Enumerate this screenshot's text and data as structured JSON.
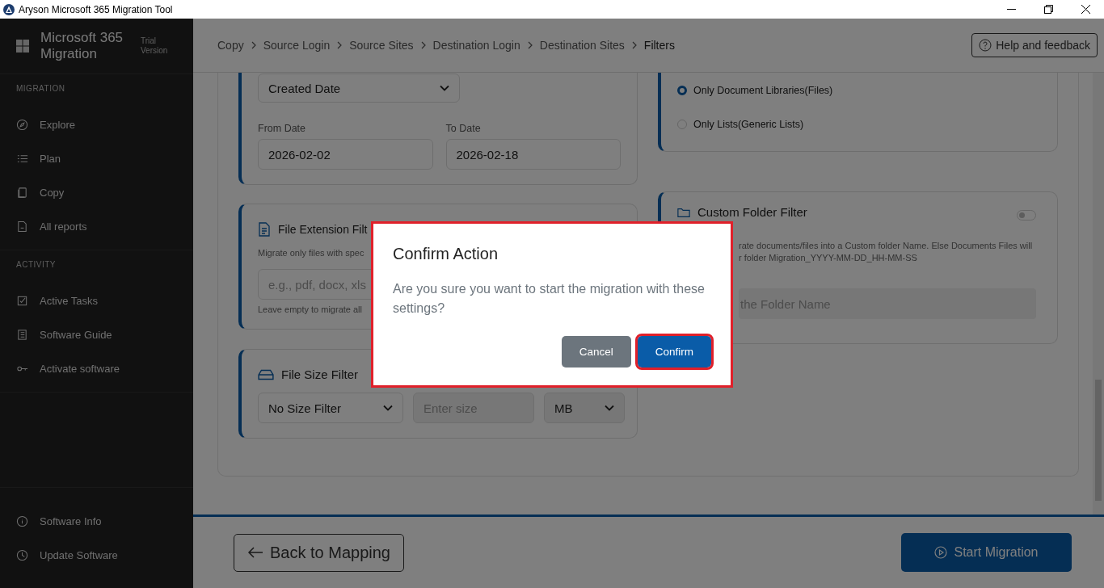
{
  "window": {
    "title": "Aryson Microsoft 365 Migration Tool"
  },
  "sidebar": {
    "app_name": "Microsoft 365 Migration",
    "edition": "Trial Version",
    "sections": [
      {
        "heading": "MIGRATION",
        "items": [
          {
            "label": "Explore"
          },
          {
            "label": "Plan"
          },
          {
            "label": "Copy"
          },
          {
            "label": "All reports"
          }
        ]
      },
      {
        "heading": "ACTIVITY",
        "items": [
          {
            "label": "Active Tasks"
          },
          {
            "label": "Software Guide"
          },
          {
            "label": "Activate software"
          }
        ]
      }
    ],
    "footer_items": [
      {
        "label": "Software Info"
      },
      {
        "label": "Update Software"
      }
    ]
  },
  "breadcrumbs": [
    {
      "label": "Copy",
      "current": false
    },
    {
      "label": "Source Login",
      "current": false
    },
    {
      "label": "Source Sites",
      "current": false
    },
    {
      "label": "Destination Login",
      "current": false
    },
    {
      "label": "Destination Sites",
      "current": false
    },
    {
      "label": "Filters",
      "current": true
    }
  ],
  "help_button": "Help and feedback",
  "date_filter": {
    "field": "Created Date",
    "from_label": "From Date",
    "from_value": "2026-02-02",
    "to_label": "To Date",
    "to_value": "2026-02-18"
  },
  "extension_filter": {
    "title": "File Extension Filt",
    "description": "Migrate only files with spec",
    "placeholder": "e.g., pdf, docx, xls",
    "hint": "Leave empty to migrate all"
  },
  "size_filter": {
    "title": "File Size Filter",
    "mode": "No Size Filter",
    "size_placeholder": "Enter size",
    "unit": "MB"
  },
  "content_type": {
    "options": [
      {
        "label": "Only Document Libraries(Files)",
        "selected": true
      },
      {
        "label": "Only Lists(Generic Lists)",
        "selected": false
      }
    ]
  },
  "custom_folder": {
    "title": "Custom Folder Filter",
    "on": false,
    "description_lines": [
      "rate documents/files into a Custom folder Name. Else Documents Files will",
      "r folder Migration_YYYY-MM-DD_HH-MM-SS"
    ],
    "placeholder": "the Folder Name"
  },
  "footer": {
    "back_button": "Back to Mapping",
    "start_button": "Start Migration"
  },
  "dialog": {
    "title": "Confirm Action",
    "message": "Are you sure you want to start the migration with these settings?",
    "highlighted": true,
    "buttons": [
      {
        "label": "Cancel",
        "kind": "secondary",
        "highlighted": false
      },
      {
        "label": "Confirm",
        "kind": "primary",
        "highlighted": true
      }
    ]
  }
}
